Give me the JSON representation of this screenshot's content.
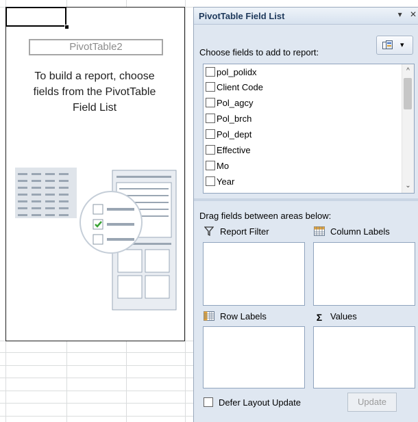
{
  "pivot": {
    "name": "PivotTable2",
    "hint": "To build a report, choose\nfields from the PivotTable\nField List"
  },
  "pane": {
    "title": "PivotTable Field List",
    "menu_arrow": "▾",
    "close": "✕",
    "choose_label": "Choose fields to add to report:",
    "layout_button_dropdown": "▾",
    "fields": [
      {
        "label": "pol_polidx",
        "checked": false
      },
      {
        "label": "Client Code",
        "checked": false
      },
      {
        "label": "Pol_agcy",
        "checked": false
      },
      {
        "label": "Pol_brch",
        "checked": false
      },
      {
        "label": "Pol_dept",
        "checked": false
      },
      {
        "label": "Effective",
        "checked": false
      },
      {
        "label": "Mo",
        "checked": false
      },
      {
        "label": "Year",
        "checked": false
      }
    ],
    "drag_label": "Drag fields between areas below:",
    "zones": {
      "report_filter": "Report Filter",
      "column_labels": "Column Labels",
      "row_labels": "Row Labels",
      "values": "Values"
    },
    "defer_label": "Defer Layout Update",
    "update_label": "Update"
  },
  "colors": {
    "pane_bg": "#dfe7f1",
    "title_text": "#1e395b",
    "check_green": "#3aa335"
  }
}
